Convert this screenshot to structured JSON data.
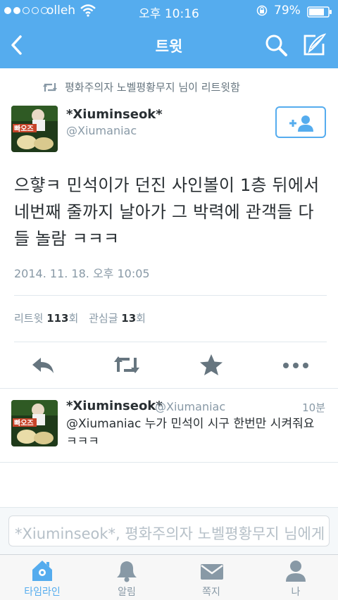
{
  "status_bar": {
    "carrier": "olleh",
    "time": "오후 10:16",
    "battery": "79%"
  },
  "nav": {
    "title": "트윗"
  },
  "retweet_notice": "평화주의자 노벨평황무지 님이 리트윗함",
  "tweet": {
    "author_name": "*Xiuminseok*",
    "author_handle": "@Xiumaniac",
    "text": "으햫ㅋ 민석이가 던진 사인볼이 1층 뒤에서 네번째 줄까지 날아가 그 박력에 관객들 다들 놀람 ㅋㅋㅋ",
    "timestamp": "2014. 11. 18. 오후 10:05",
    "avatar_label": "빠오즈"
  },
  "stats": {
    "retweet_label": "리트윗",
    "retweet_count": "113",
    "retweet_suffix": "회",
    "favorite_label": "관심글",
    "favorite_count": "13",
    "favorite_suffix": "회"
  },
  "reply": {
    "author_name": "*Xiuminseok*",
    "author_handle": "@Xiumaniac",
    "time": "10분",
    "text": "@Xiumaniac 누가 민석이 시구 한번만 시켜줘요 ㅋㅋㅋ"
  },
  "reply_input": {
    "placeholder": "*Xiuminseok*, 평화주의자 노벨평황무지 님에게 답글"
  },
  "tabs": [
    {
      "label": "타임라인",
      "icon": "home-icon",
      "active": true
    },
    {
      "label": "알림",
      "icon": "bell-icon",
      "active": false
    },
    {
      "label": "쪽지",
      "icon": "envelope-icon",
      "active": false
    },
    {
      "label": "나",
      "icon": "person-icon",
      "active": false
    }
  ],
  "colors": {
    "brand_blue": "#55acee",
    "text_dark": "#292f33",
    "text_gray": "#8899a6",
    "divider": "#e1e8ed"
  }
}
